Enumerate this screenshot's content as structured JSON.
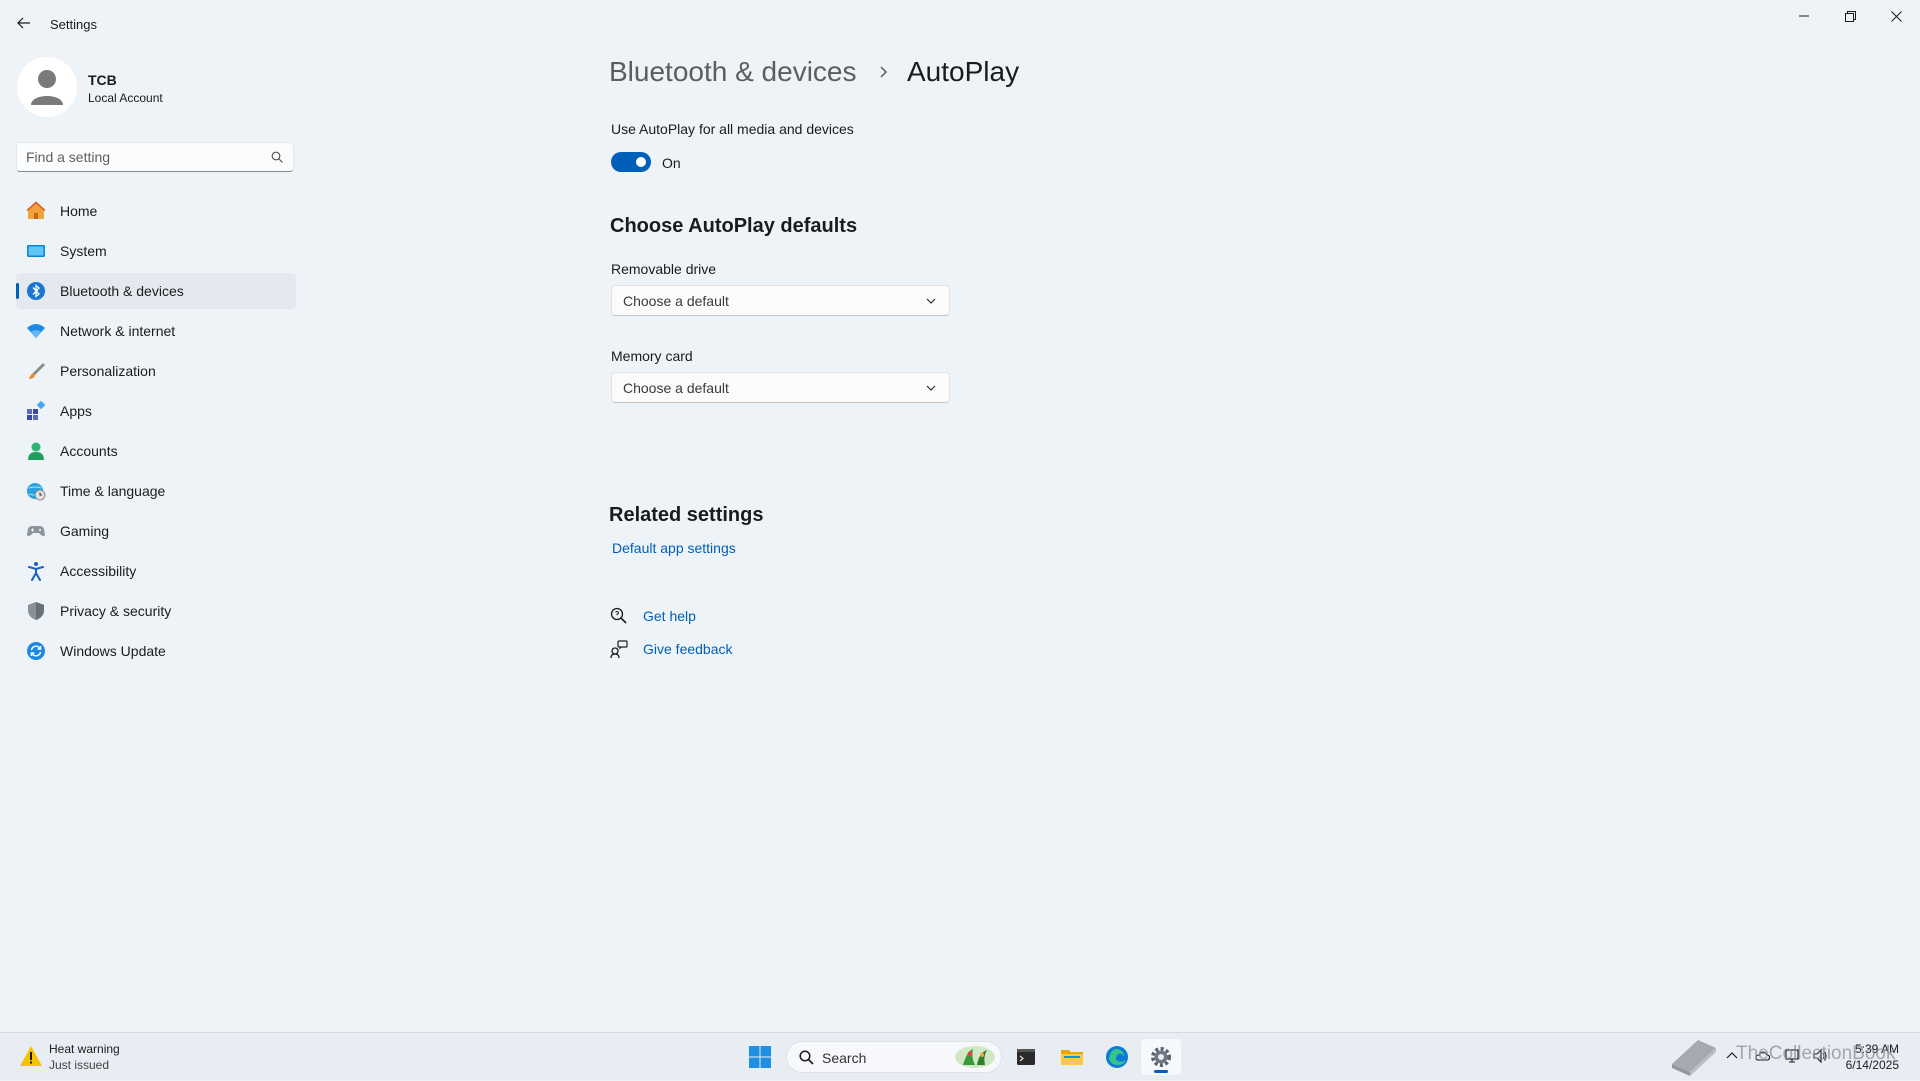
{
  "window": {
    "app_title": "Settings"
  },
  "profile": {
    "name": "TCB",
    "account_type": "Local Account"
  },
  "search": {
    "placeholder": "Find a setting"
  },
  "sidebar": {
    "items": [
      {
        "label": "Home",
        "icon": "home-icon"
      },
      {
        "label": "System",
        "icon": "system-icon"
      },
      {
        "label": "Bluetooth & devices",
        "icon": "bluetooth-icon",
        "active": true
      },
      {
        "label": "Network & internet",
        "icon": "wifi-icon"
      },
      {
        "label": "Personalization",
        "icon": "brush-icon"
      },
      {
        "label": "Apps",
        "icon": "apps-icon"
      },
      {
        "label": "Accounts",
        "icon": "accounts-icon"
      },
      {
        "label": "Time & language",
        "icon": "globe-clock-icon"
      },
      {
        "label": "Gaming",
        "icon": "gamepad-icon"
      },
      {
        "label": "Accessibility",
        "icon": "accessibility-icon"
      },
      {
        "label": "Privacy & security",
        "icon": "shield-icon"
      },
      {
        "label": "Windows Update",
        "icon": "update-icon"
      }
    ]
  },
  "breadcrumb": {
    "parent": "Bluetooth & devices",
    "current": "AutoPlay"
  },
  "autoplay": {
    "toggle_description": "Use AutoPlay for all media and devices",
    "toggle_state": "On",
    "toggle_on": true
  },
  "defaults": {
    "section_title": "Choose AutoPlay defaults",
    "removable_drive": {
      "label": "Removable drive",
      "value": "Choose a default"
    },
    "memory_card": {
      "label": "Memory card",
      "value": "Choose a default"
    }
  },
  "related": {
    "title": "Related settings",
    "default_apps_link": "Default app settings"
  },
  "help": {
    "get_help": "Get help",
    "give_feedback": "Give feedback"
  },
  "taskbar": {
    "notification_title": "Heat warning",
    "notification_sub": "Just issued",
    "search_label": "Search",
    "time": "5:39 AM",
    "date": "6/14/2025",
    "watermark": "TheCollectionBook"
  },
  "colors": {
    "accent": "#005fb8",
    "background": "#eef3f8",
    "warning": "#f2c400"
  }
}
